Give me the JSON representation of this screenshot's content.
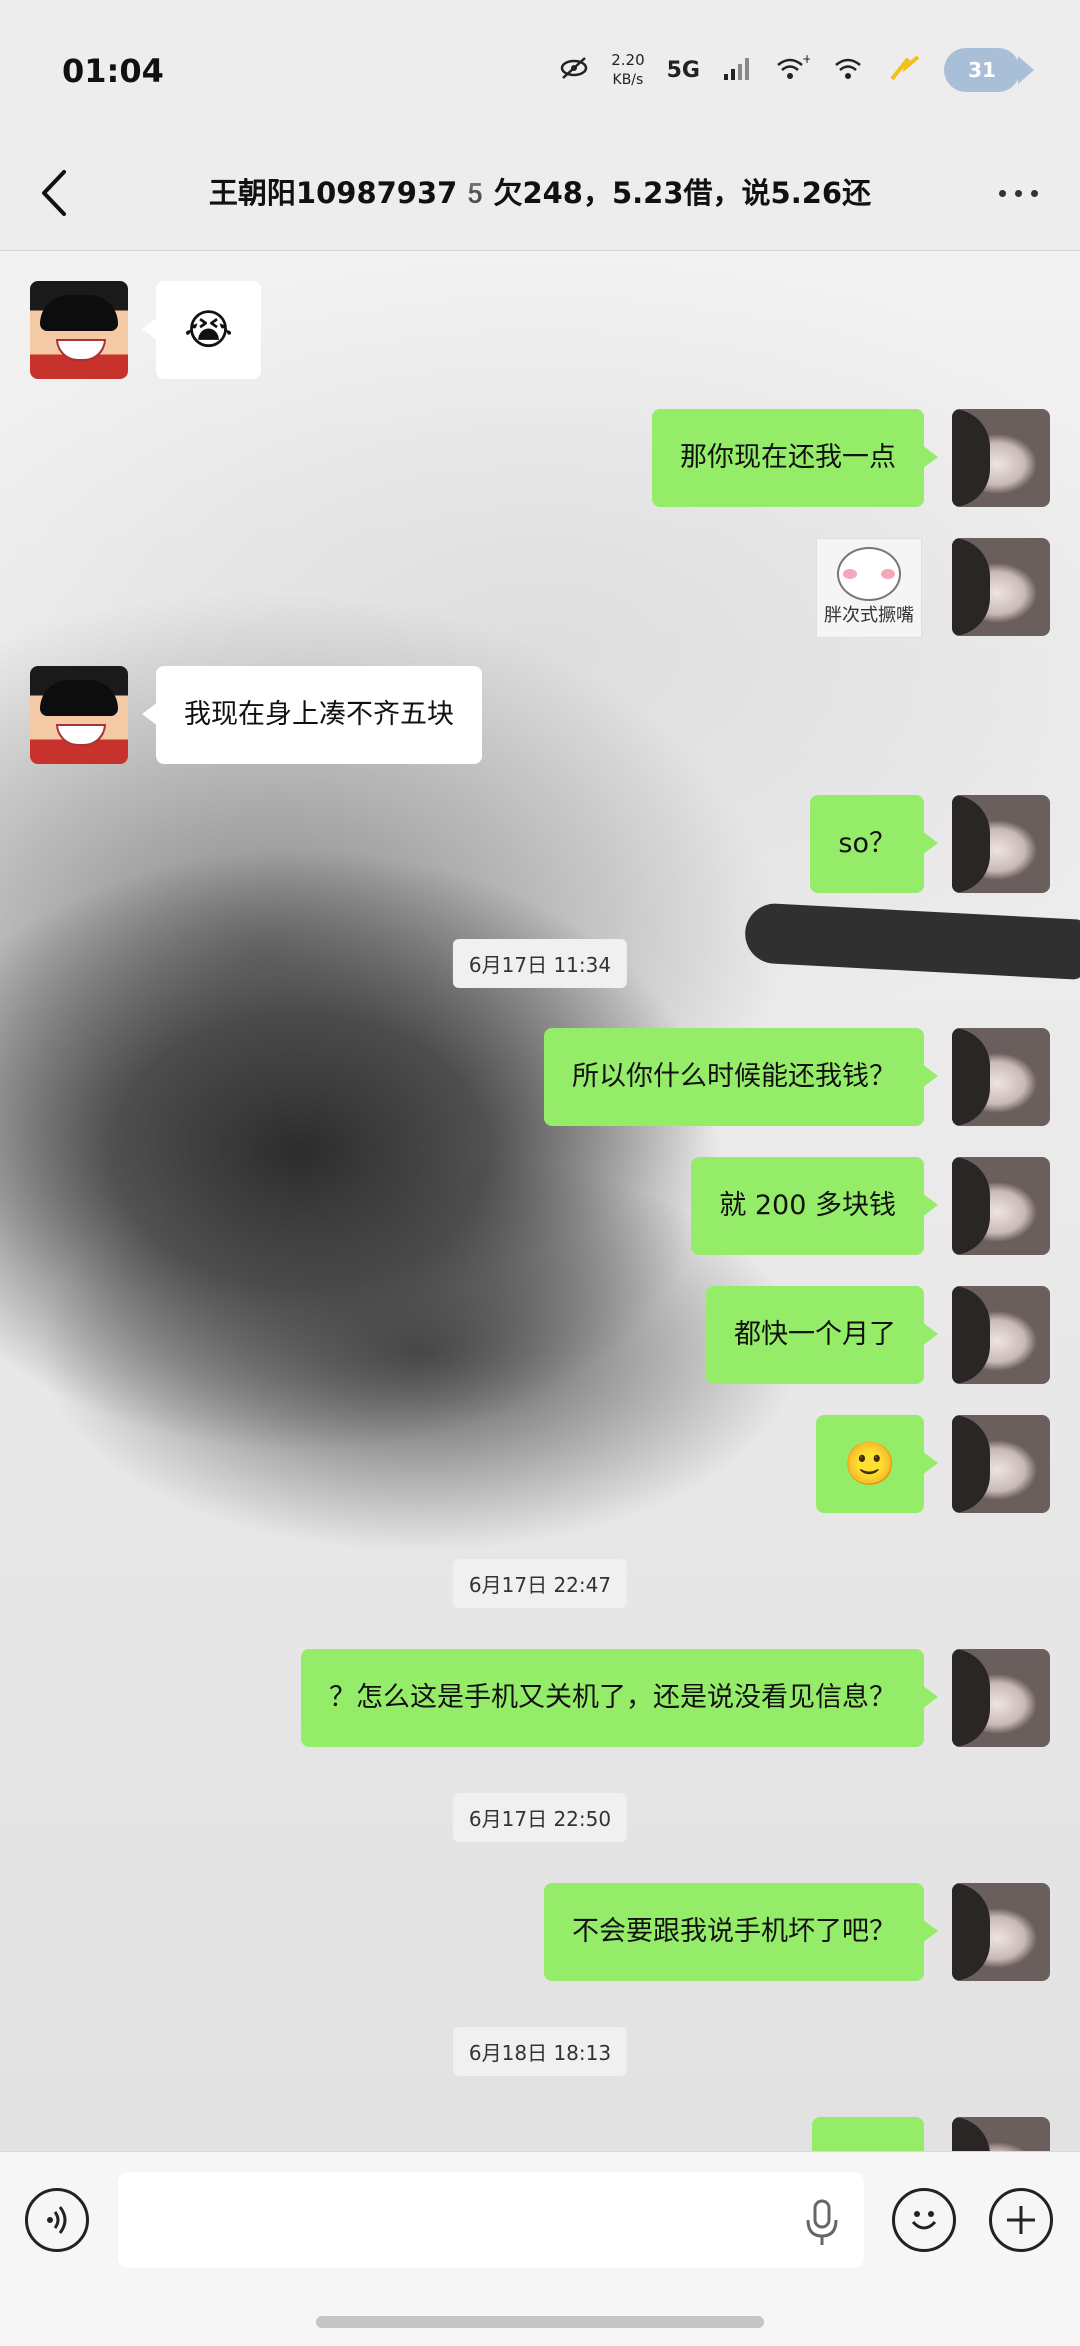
{
  "status_bar": {
    "time": "01:04",
    "net_speed_value": "2.20",
    "net_speed_unit": "KB/s",
    "network": "5G",
    "battery": "31",
    "icons": [
      "eye-off-icon",
      "signal-icon",
      "wifi-plus-icon",
      "wifi-icon",
      "charging-icon",
      "battery-fish-icon"
    ]
  },
  "nav": {
    "title": "王朝阳109879375️欠248，5.23借，说5.26还️",
    "back_icon": "chevron-left-icon",
    "more_icon": "more-dots-icon"
  },
  "messages": [
    {
      "from": "them",
      "type": "emoji",
      "content": "😭"
    },
    {
      "from": "me",
      "type": "text",
      "content": "那你现在还我一点"
    },
    {
      "from": "me",
      "type": "sticker",
      "content": "胖次式撅嘴"
    },
    {
      "from": "them",
      "type": "text",
      "content": "我现在身上凑不齐五块"
    },
    {
      "from": "me",
      "type": "text",
      "content": "so？"
    },
    {
      "from": "system",
      "type": "time",
      "content": "6月17日 11:34"
    },
    {
      "from": "me",
      "type": "text",
      "content": "所以你什么时候能还我钱？"
    },
    {
      "from": "me",
      "type": "text",
      "content": "就 200 多块钱"
    },
    {
      "from": "me",
      "type": "text",
      "content": "都快一个月了"
    },
    {
      "from": "me",
      "type": "emoji",
      "content": "🙂"
    },
    {
      "from": "system",
      "type": "time",
      "content": "6月17日 22:47"
    },
    {
      "from": "me",
      "type": "text",
      "content": "？怎么这是手机又关机了，还是说没看见信息？"
    },
    {
      "from": "system",
      "type": "time",
      "content": "6月17日 22:50"
    },
    {
      "from": "me",
      "type": "text",
      "content": "不会要跟我说手机坏了吧？"
    },
    {
      "from": "system",
      "type": "time",
      "content": "6月18日 18:13"
    }
  ],
  "input_bar": {
    "placeholder": "",
    "voice_icon": "voice-icon",
    "mic_icon": "microphone-icon",
    "emoji_icon": "emoji-icon",
    "plus_icon": "plus-icon"
  },
  "colors": {
    "my_bubble": "#95ec69",
    "their_bubble": "#ffffff",
    "bar_background": "#ededed"
  }
}
